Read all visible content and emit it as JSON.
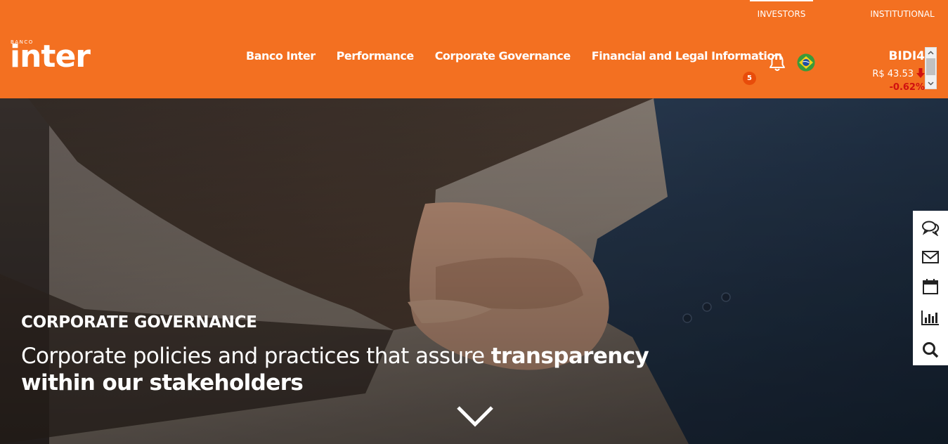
{
  "top_links": {
    "investors": "INVESTORS",
    "institutional": "INSTITUTIONAL"
  },
  "logo": {
    "small": "BANCO",
    "main": "inter"
  },
  "nav": [
    "Banco Inter",
    "Performance",
    "Corporate Governance",
    "Financial and Legal Information"
  ],
  "notifications": {
    "count": "5"
  },
  "ticker": {
    "symbol": "BIDI4",
    "price": "R$ 43.53",
    "change": "-0.62%"
  },
  "hero": {
    "kicker": "CORPORATE GOVERNANCE",
    "line_regular": "Corporate policies and practices that assure ",
    "line_bold_1": "transparency",
    "line_bold_2": "within our stakeholders"
  },
  "side_tools": [
    "chat-icon",
    "mail-icon",
    "calendar-icon",
    "chart-icon",
    "search-icon"
  ],
  "colors": {
    "brand_orange": "#f37021",
    "negative_red": "#d01010"
  }
}
